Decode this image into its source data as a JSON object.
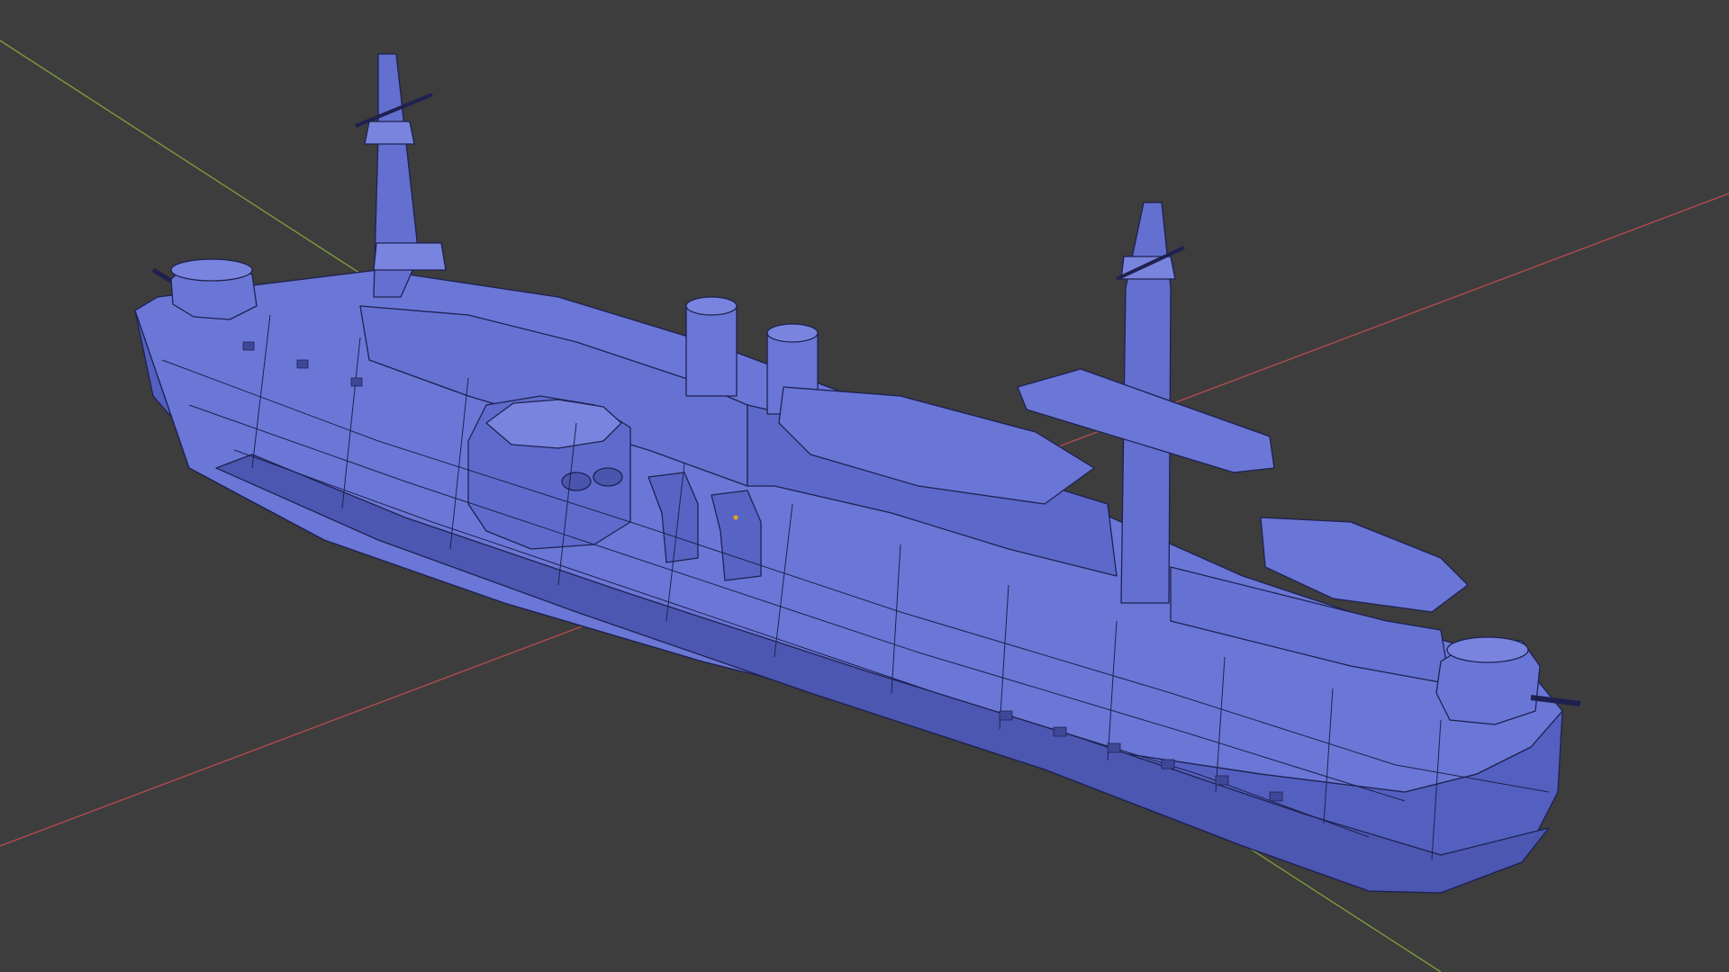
{
  "viewport": {
    "background_color": "#3d3d3d",
    "shading_mode": "solid",
    "overlay": "wireframe"
  },
  "axes": {
    "x_axis_color": "#b04a50",
    "y_axis_color": "#7e9a3a"
  },
  "model": {
    "subject": "warship",
    "face_color": "#5b66c8",
    "face_light_color": "#6e79d8",
    "face_dark_color": "#4650a8",
    "wire_color": "#1e2150",
    "origin_color": "#e8a317",
    "parts": [
      "hull",
      "fore-mast",
      "main-mast",
      "funnel",
      "funnel",
      "main-turret",
      "fore-turret",
      "aft-turret",
      "lifeboat",
      "lifeboat",
      "yard-arm",
      "ventilator"
    ]
  }
}
